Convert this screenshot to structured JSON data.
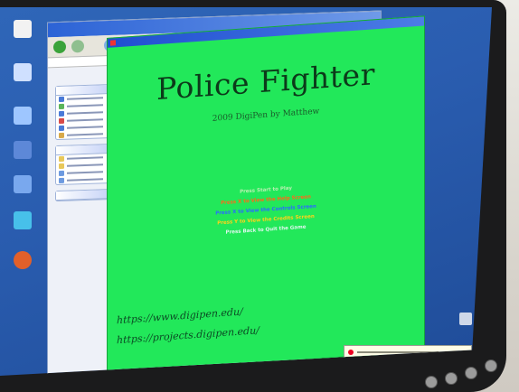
{
  "game_window": {
    "title": "Police Fighter",
    "subtitle": "2009 DigiPen by Matthew",
    "instructions": [
      {
        "text": "Press Start to Play",
        "color": "#b8f0b0"
      },
      {
        "text": "Press X to View the Help Screen",
        "color": "#ff6a1a"
      },
      {
        "text": "Press X to View the Controls Screen",
        "color": "#2a6cff"
      },
      {
        "text": "Press Y to View the Credits Screen",
        "color": "#ffd21a"
      },
      {
        "text": "Press Back to Quit the Game",
        "color": "#dff7ee"
      }
    ],
    "urls": [
      "https://www.digipen.edu/",
      "https://projects.digipen.edu/"
    ],
    "background_color": "#22e85a"
  },
  "desktop_icons": [
    {
      "name": "my-documents-icon",
      "color": "#f2f2f2"
    },
    {
      "name": "my-computer-icon",
      "color": "#cfe0ff"
    },
    {
      "name": "network-icon",
      "color": "#9ec6ff"
    },
    {
      "name": "shortcut-icon",
      "color": "#79a8ee"
    },
    {
      "name": "firefox-icon",
      "color": "#e2602a"
    }
  ],
  "colors": {
    "desktop_blue": "#2a5db0",
    "bezel": "#1b1b1c"
  }
}
